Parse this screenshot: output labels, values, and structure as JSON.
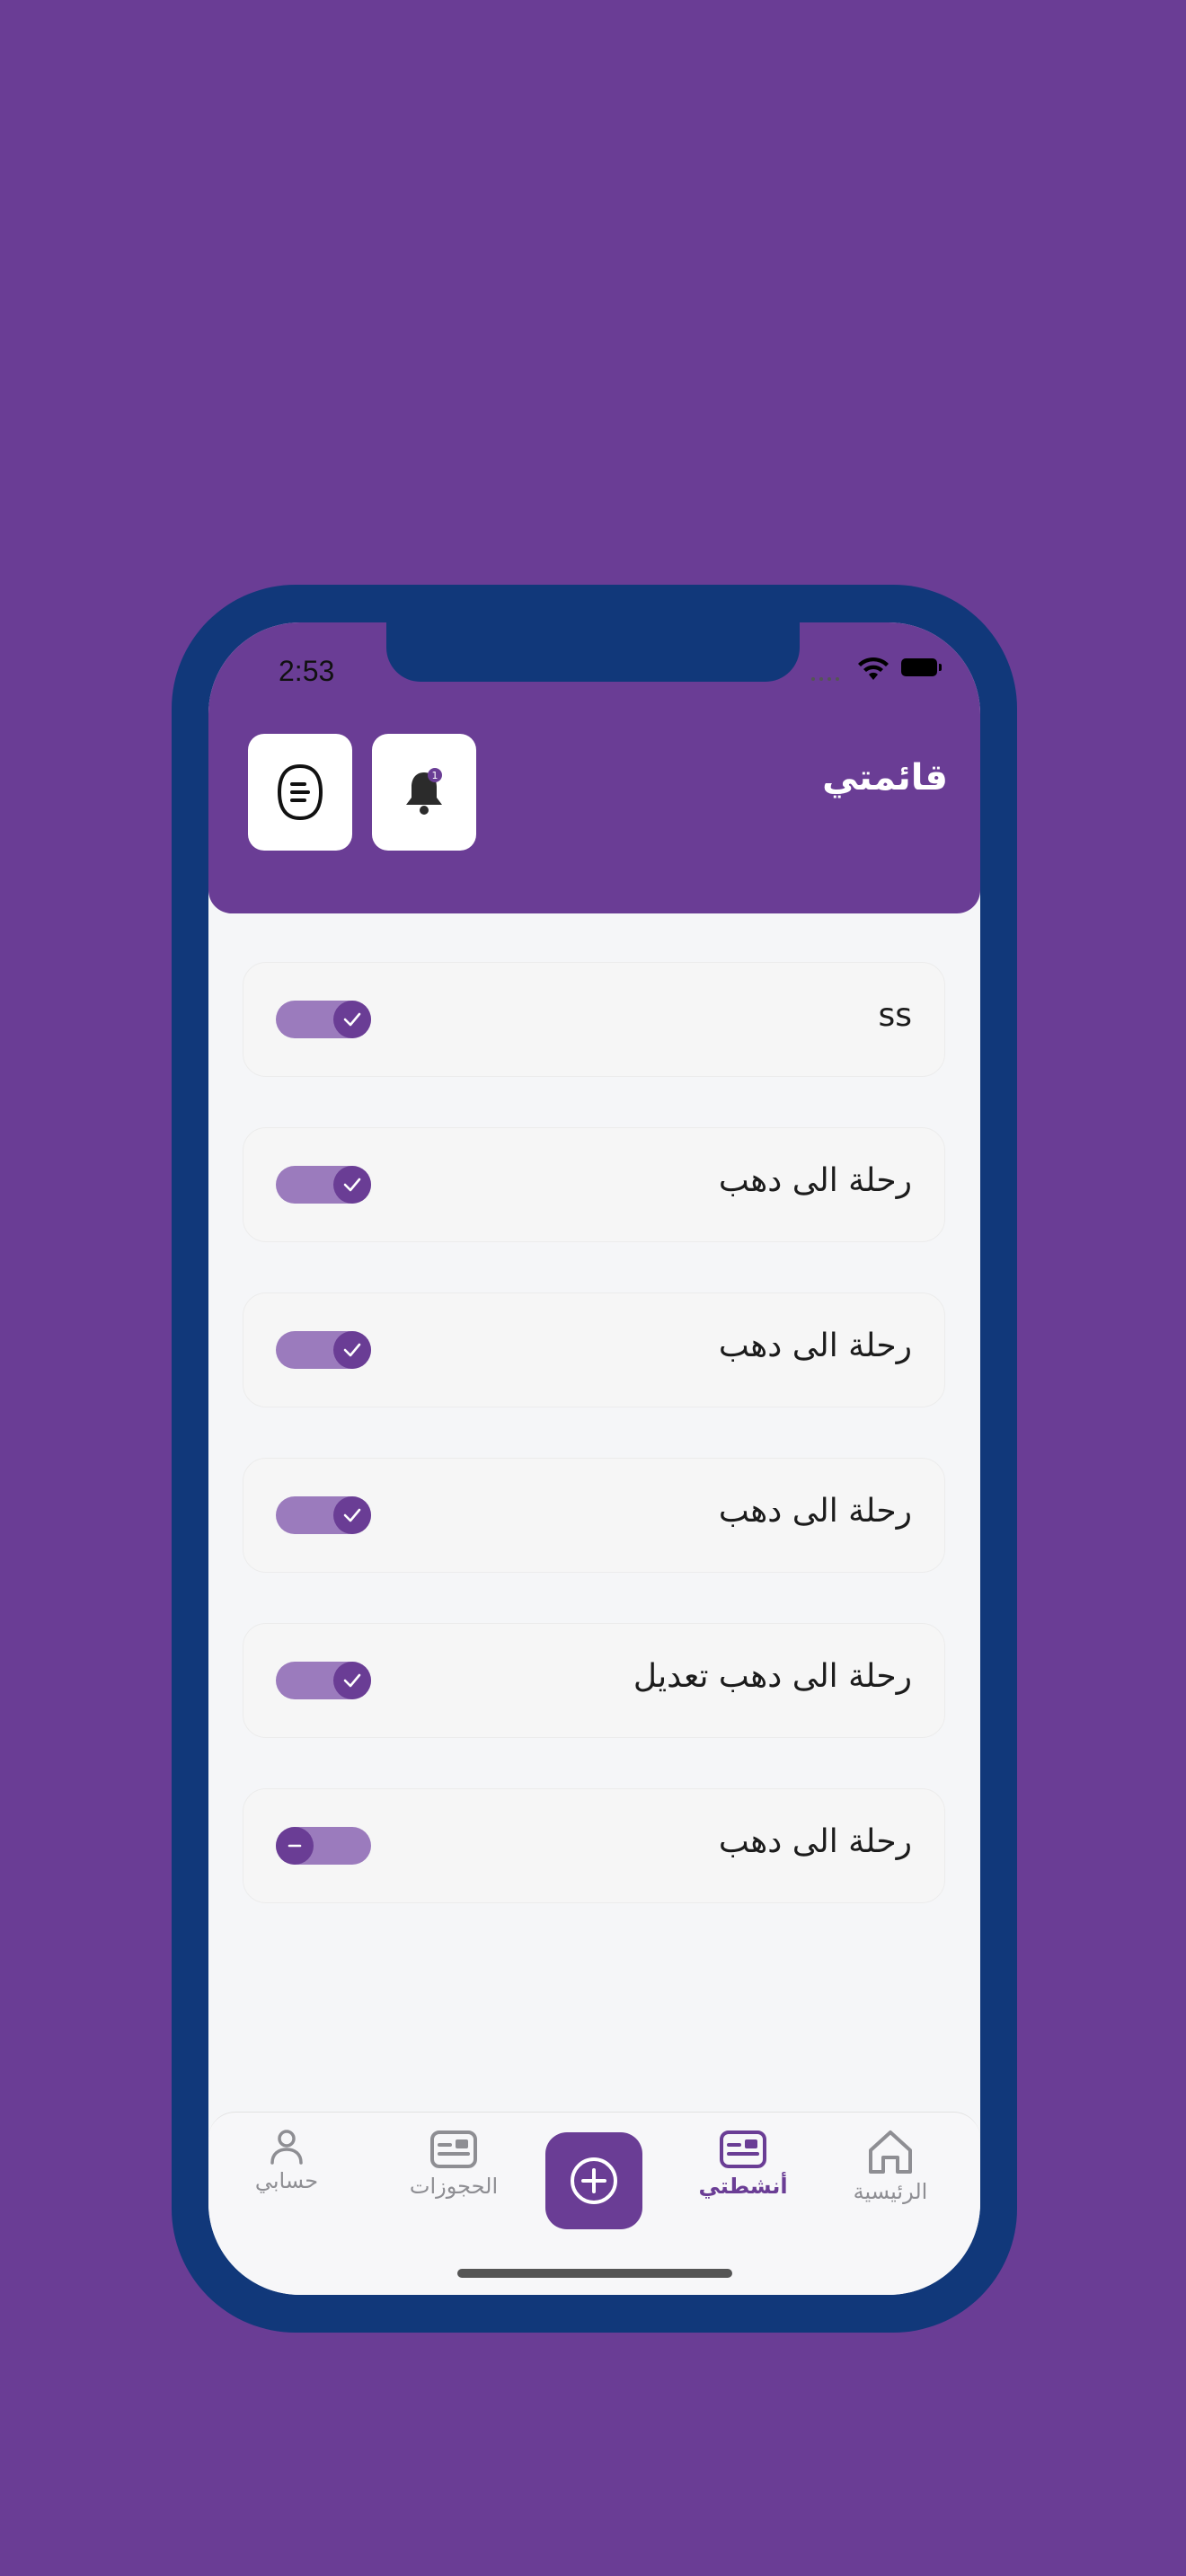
{
  "status_bar": {
    "time": "2:53"
  },
  "header": {
    "title": "قائمتي"
  },
  "icons": {
    "menu": "list-icon",
    "notifications": "bell-icon",
    "add": "plus-circle-icon",
    "home": "home-icon",
    "activities": "card-icon",
    "bookings": "card-icon",
    "account": "person-icon"
  },
  "items": [
    {
      "label": "ss",
      "enabled": true
    },
    {
      "label": "رحلة الى دهب",
      "enabled": true
    },
    {
      "label": "رحلة الى دهب",
      "enabled": true
    },
    {
      "label": "رحلة الى دهب",
      "enabled": true
    },
    {
      "label": "رحلة الى دهب تعديل",
      "enabled": true
    },
    {
      "label": "رحلة الى دهب",
      "enabled": false
    }
  ],
  "tabs": {
    "home": "الرئيسية",
    "activities": "أنشطتي",
    "bookings": "الحجوزات",
    "account": "حسابي"
  },
  "colors": {
    "primary": "#6a3d95",
    "frame": "#11387a",
    "toggle_track": "#9b7bbd"
  }
}
